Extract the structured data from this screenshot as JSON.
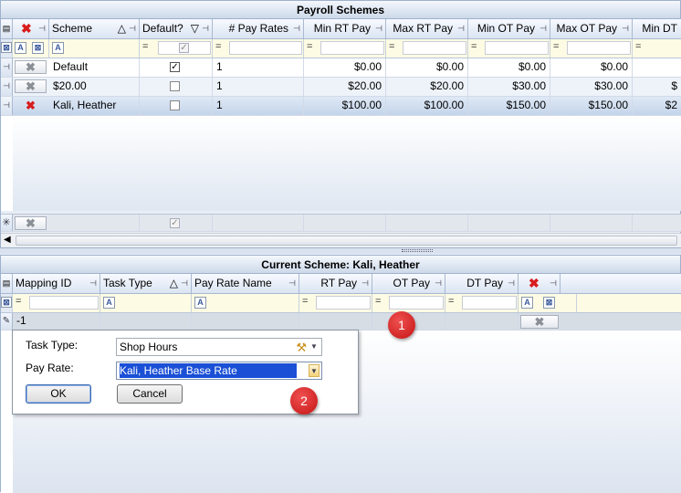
{
  "top": {
    "title": "Payroll Schemes",
    "columns": [
      "Scheme",
      "Default?",
      "# Pay Rates",
      "Min RT Pay",
      "Max RT Pay",
      "Min OT Pay",
      "Max OT Pay",
      "Min DT"
    ],
    "rows": [
      {
        "scheme": "Default",
        "default": "✓",
        "rates": "1",
        "min_rt": "$0.00",
        "max_rt": "$0.00",
        "min_ot": "$0.00",
        "max_ot": "$0.00",
        "min_dt": ""
      },
      {
        "scheme": "$20.00",
        "default": "",
        "rates": "1",
        "min_rt": "$20.00",
        "max_rt": "$20.00",
        "min_ot": "$30.00",
        "max_ot": "$30.00",
        "min_dt": "$"
      },
      {
        "scheme": "Kali, Heather",
        "default": "",
        "rates": "1",
        "min_rt": "$100.00",
        "max_rt": "$100.00",
        "min_ot": "$150.00",
        "max_ot": "$150.00",
        "min_dt": "$2"
      }
    ],
    "filter_op": "="
  },
  "bottom": {
    "title": "Current Scheme: Kali, Heather",
    "columns": [
      "Mapping ID",
      "Task Type",
      "Pay Rate Name",
      "RT Pay",
      "OT Pay",
      "DT Pay"
    ],
    "row_id": "-1",
    "filter_op": "="
  },
  "editor": {
    "task_type_label": "Task Type:",
    "task_type_value": "Shop Hours",
    "pay_rate_label": "Pay Rate:",
    "pay_rate_value": "Kali, Heather Base Rate",
    "ok_label": "OK",
    "cancel_label": "Cancel"
  },
  "badges": [
    "1",
    "2"
  ],
  "icons": {
    "delete": "✖",
    "pin": "⊣",
    "filter_clear": "filter-clear-icon",
    "new_row": "✳",
    "tool": "tool-icon"
  },
  "colors": {
    "accent_red": "#d81c1c",
    "selection": "#1a4fd6"
  }
}
